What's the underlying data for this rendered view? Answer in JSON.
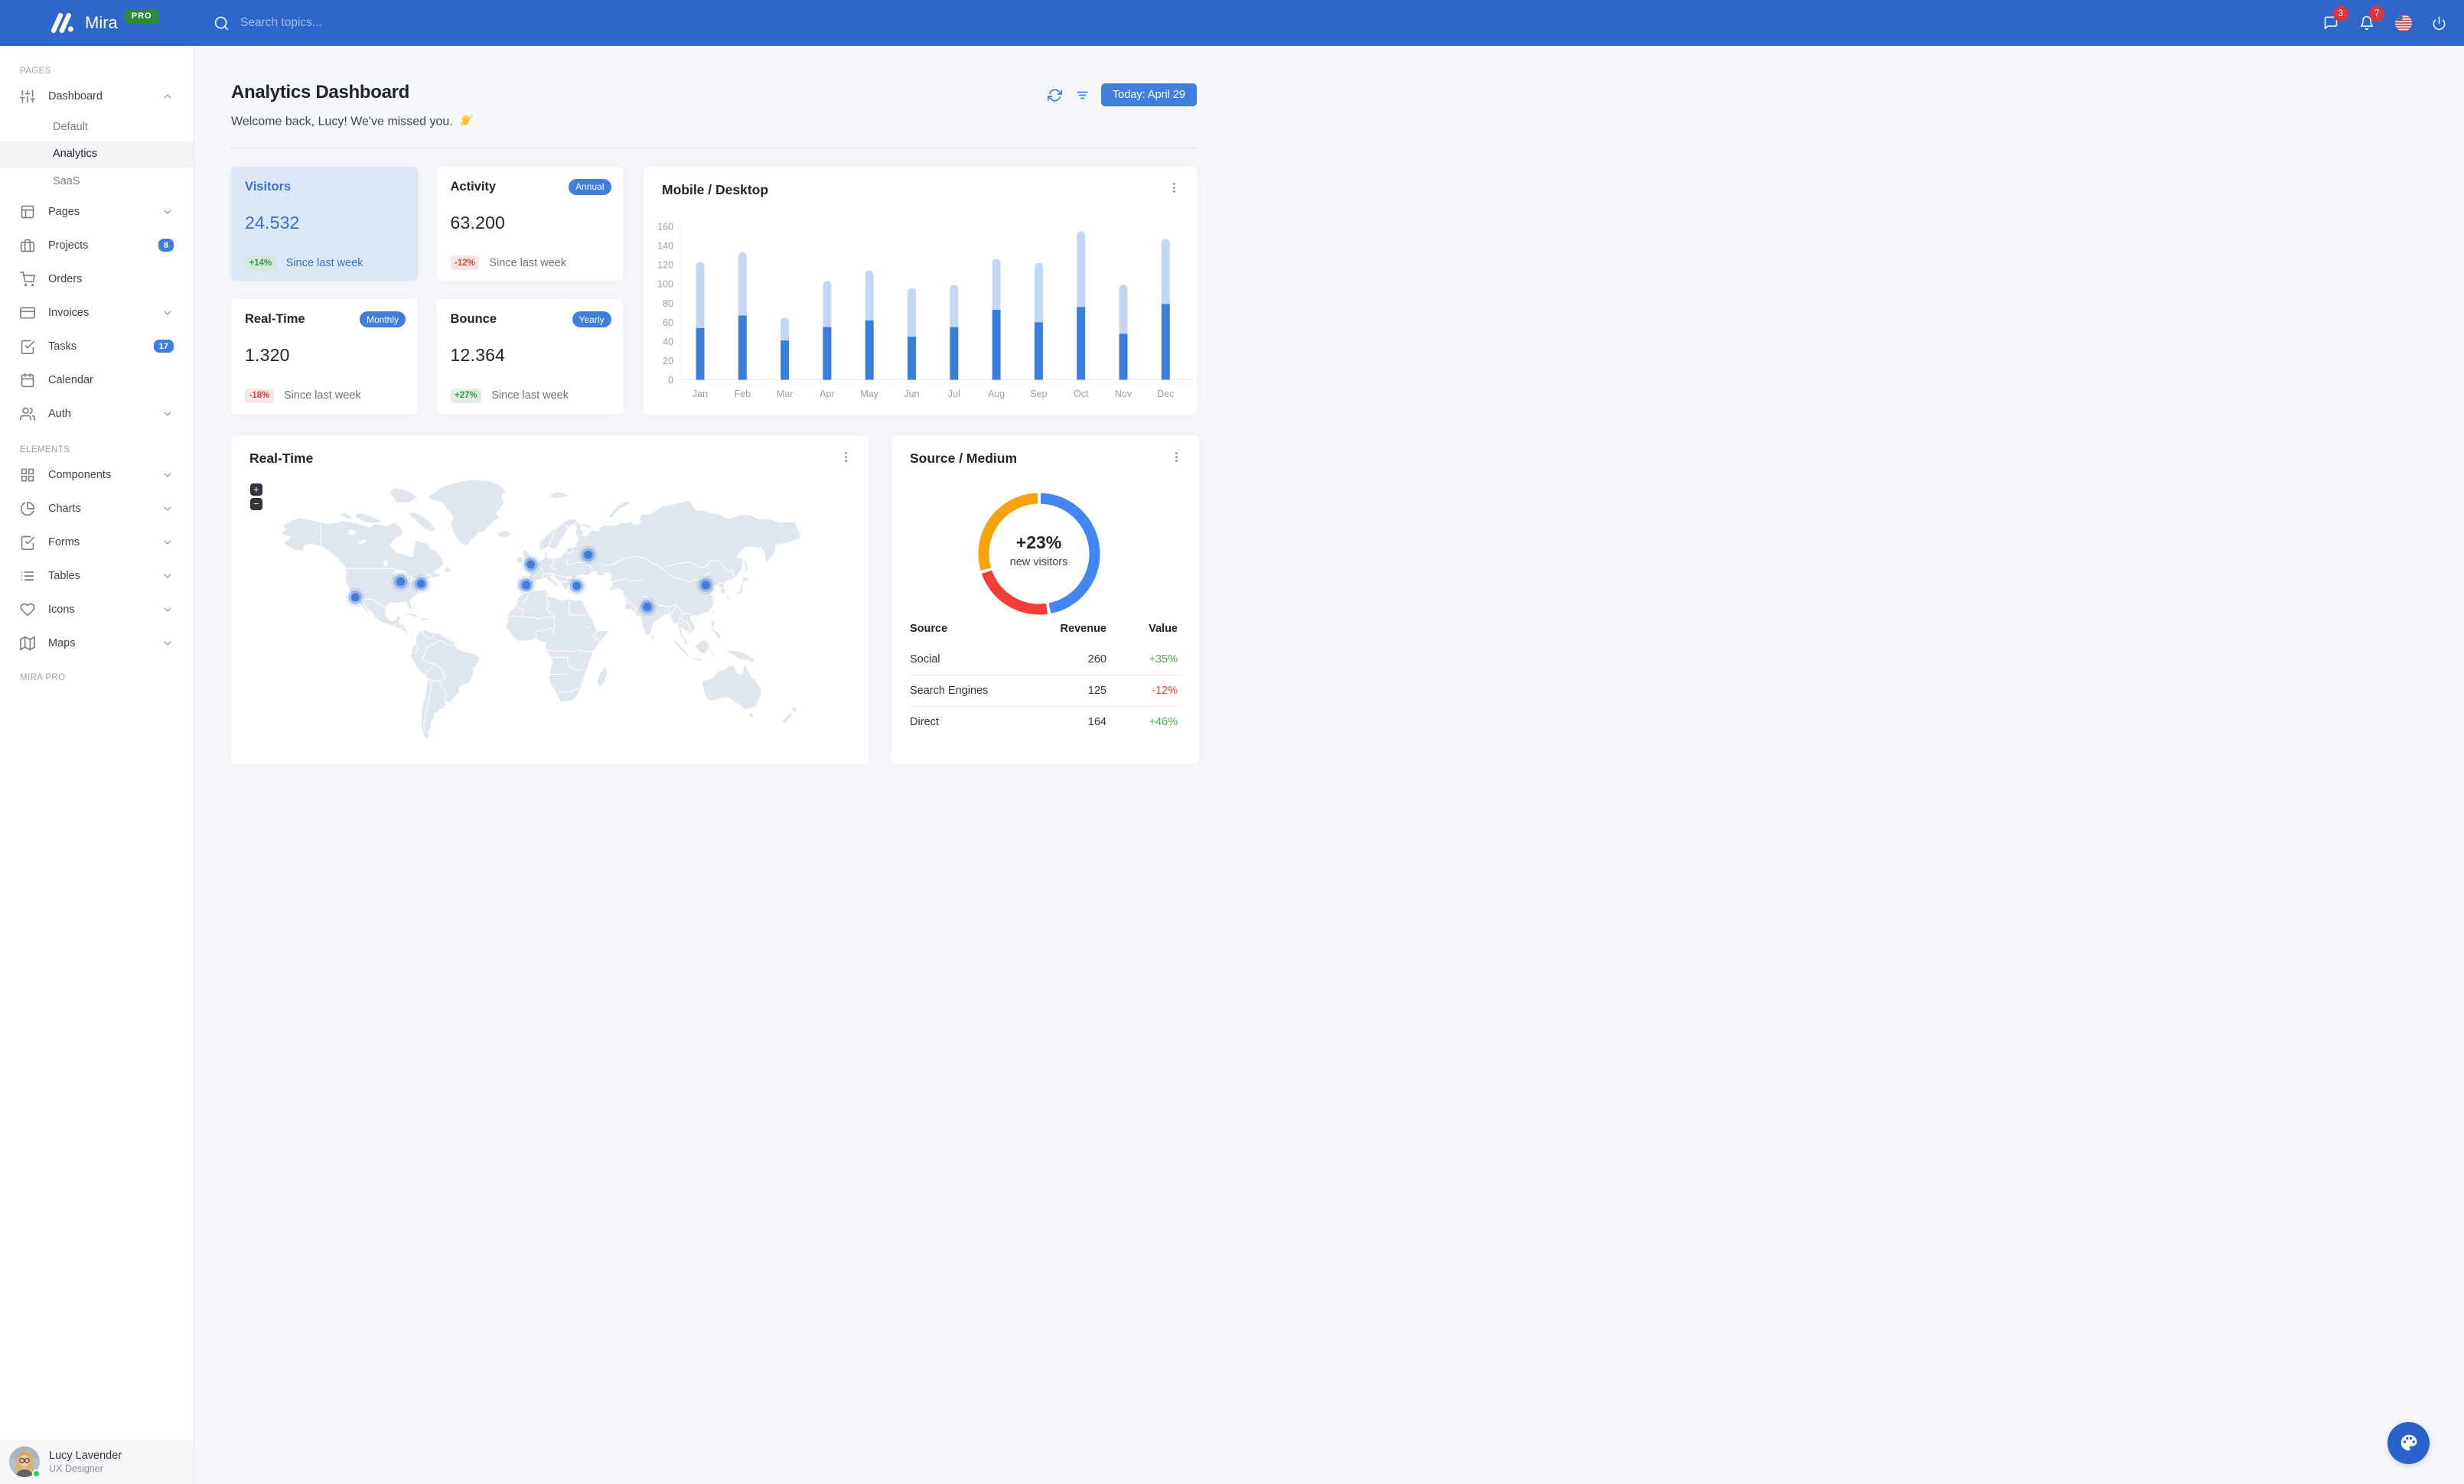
{
  "brand": {
    "name": "Mira",
    "badge": "PRO"
  },
  "navbar": {
    "search_placeholder": "Search topics...",
    "messages_count": "3",
    "notifications_count": "7"
  },
  "sidebar": {
    "sections": [
      {
        "title": "PAGES",
        "items": [
          {
            "label": "Dashboard",
            "icon": "sliders",
            "chevron": "up",
            "children": [
              {
                "label": "Default",
                "active": false
              },
              {
                "label": "Analytics",
                "active": true
              },
              {
                "label": "SaaS",
                "active": false
              }
            ]
          },
          {
            "label": "Pages",
            "icon": "layout",
            "chevron": "down"
          },
          {
            "label": "Projects",
            "icon": "briefcase",
            "badge": "8"
          },
          {
            "label": "Orders",
            "icon": "shopping-cart"
          },
          {
            "label": "Invoices",
            "icon": "credit-card",
            "chevron": "down"
          },
          {
            "label": "Tasks",
            "icon": "check-square",
            "badge": "17"
          },
          {
            "label": "Calendar",
            "icon": "calendar"
          },
          {
            "label": "Auth",
            "icon": "users",
            "chevron": "down"
          }
        ]
      },
      {
        "title": "ELEMENTS",
        "items": [
          {
            "label": "Components",
            "icon": "grid",
            "chevron": "down"
          },
          {
            "label": "Charts",
            "icon": "pie-chart",
            "chevron": "down"
          },
          {
            "label": "Forms",
            "icon": "check-square",
            "chevron": "down"
          },
          {
            "label": "Tables",
            "icon": "list",
            "chevron": "down"
          },
          {
            "label": "Icons",
            "icon": "heart",
            "chevron": "down"
          },
          {
            "label": "Maps",
            "icon": "map",
            "chevron": "down"
          }
        ]
      },
      {
        "title": "MIRA PRO",
        "items": []
      }
    ],
    "user": {
      "name": "Lucy Lavender",
      "role": "UX Designer"
    }
  },
  "header": {
    "title": "Analytics Dashboard",
    "subtitle": "Welcome back, Lucy! We've missed you.",
    "wave_icon": "waving-hand",
    "date_button": "Today: April 29"
  },
  "stats": [
    {
      "title": "Visitors",
      "value": "24.532",
      "delta": "+14%",
      "delta_dir": "up",
      "note": "Since last week",
      "highlight": true
    },
    {
      "title": "Activity",
      "value": "63.200",
      "delta": "-12%",
      "delta_dir": "down",
      "note": "Since last week",
      "tag": "Annual"
    },
    {
      "title": "Real-Time",
      "value": "1.320",
      "delta": "-18%",
      "delta_dir": "down",
      "note": "Since last week",
      "tag": "Monthly"
    },
    {
      "title": "Bounce",
      "value": "12.364",
      "delta": "+27%",
      "delta_dir": "up",
      "note": "Since last week",
      "tag": "Yearly"
    }
  ],
  "chart_data": [
    {
      "type": "bar",
      "title": "Mobile / Desktop",
      "stacked": true,
      "categories": [
        "Jan",
        "Feb",
        "Mar",
        "Apr",
        "May",
        "Jun",
        "Jul",
        "Aug",
        "Sep",
        "Oct",
        "Nov",
        "Dec"
      ],
      "series": [
        {
          "name": "Mobile",
          "color": "#3b7ddd",
          "values": [
            54,
            67,
            41,
            55,
            62,
            45,
            55,
            73,
            60,
            76,
            48,
            79
          ]
        },
        {
          "name": "Desktop",
          "color": "#c3d7f3",
          "values": [
            69,
            66,
            24,
            48,
            52,
            51,
            44,
            53,
            62,
            79,
            51,
            68
          ]
        }
      ],
      "ylim": [
        0,
        160
      ],
      "ytick": 20,
      "grid": false,
      "legend": "none"
    },
    {
      "type": "pie",
      "title": "Source / Medium",
      "center_value": "+23%",
      "center_label": "new visitors",
      "slices": [
        {
          "label": "Social",
          "value": 260,
          "color": "#4285f4"
        },
        {
          "label": "Search Engines",
          "value": 125,
          "color": "#f23e36"
        },
        {
          "label": "Direct",
          "value": 164,
          "color": "#f9a20b"
        }
      ]
    }
  ],
  "map_card": {
    "title": "Real-Time",
    "zoom_in": "+",
    "zoom_out": "−",
    "markers": [
      {
        "city": "Los Angeles",
        "lat": 32.8,
        "lon": -118.0
      },
      {
        "city": "Chicago",
        "lat": 41.88,
        "lon": -87.63
      },
      {
        "city": "New York",
        "lat": 40.71,
        "lon": -74.01
      },
      {
        "city": "London",
        "lat": 51.0,
        "lon": -0.7
      },
      {
        "city": "Madrid",
        "lat": 40.0,
        "lon": -3.7
      },
      {
        "city": "Moscow",
        "lat": 55.75,
        "lon": 37.62
      },
      {
        "city": "Istanbul",
        "lat": 39.5,
        "lon": 30.0
      },
      {
        "city": "New Delhi",
        "lat": 27.0,
        "lon": 77.2
      },
      {
        "city": "Beijing",
        "lat": 40.0,
        "lon": 116.2
      }
    ],
    "marker_color": "#3f7edc"
  },
  "source_table": {
    "columns": [
      "Source",
      "Revenue",
      "Value"
    ],
    "rows": [
      {
        "source": "Social",
        "revenue": "260",
        "value": "+35%",
        "dir": "up"
      },
      {
        "source": "Search Engines",
        "revenue": "125",
        "value": "-12%",
        "dir": "down"
      },
      {
        "source": "Direct",
        "revenue": "164",
        "value": "+46%",
        "dir": "up"
      }
    ]
  },
  "colors": {
    "navbar": "#2f66cb",
    "primary": "#3f7edc",
    "page_bg": "#f5f7fb",
    "stat_highlight_bg": "#dce7f6",
    "success": "#2f9e44",
    "danger": "#e5403d",
    "pro_badge": "#2e8b3e",
    "fab": "#2a62c9"
  }
}
